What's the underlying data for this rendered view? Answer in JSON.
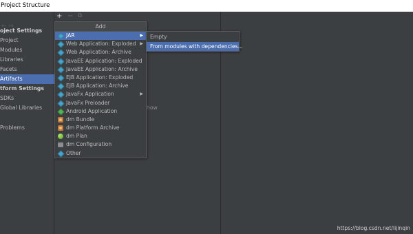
{
  "window": {
    "title": "Project Structure"
  },
  "sidebar": {
    "nav": {
      "back_icon": "arrow-left-icon",
      "forward_icon": "arrow-right-icon"
    },
    "sections": [
      {
        "header": "oject Settings",
        "items": [
          "Project",
          "Modules",
          "Libraries",
          "Facets",
          "Artifacts"
        ]
      },
      {
        "header": "tform Settings",
        "items": [
          "SDKs",
          "Global Libraries"
        ]
      }
    ],
    "problems": "Problems",
    "selected": "Artifacts"
  },
  "toolbar": {
    "add_icon": "+",
    "remove_icon": "−",
    "copy_icon": "⧉"
  },
  "middle": {
    "empty_text": "how"
  },
  "popup": {
    "title": "Add",
    "items": [
      {
        "label": "JAR",
        "icon": "jar-icon",
        "has_submenu": true,
        "selected": true
      },
      {
        "label": "Web Application: Exploded",
        "icon": "web-app-exploded-icon",
        "has_submenu": true
      },
      {
        "label": "Web Application: Archive",
        "icon": "web-app-archive-icon"
      },
      {
        "label": "JavaEE Application: Exploded",
        "icon": "javaee-exploded-icon"
      },
      {
        "label": "JavaEE Application: Archive",
        "icon": "javaee-archive-icon"
      },
      {
        "label": "EJB Application: Exploded",
        "icon": "ejb-exploded-icon"
      },
      {
        "label": "EJB Application: Archive",
        "icon": "ejb-archive-icon"
      },
      {
        "label": "JavaFx Application",
        "icon": "javafx-app-icon",
        "has_submenu": true
      },
      {
        "label": "JavaFx Preloader",
        "icon": "javafx-preloader-icon"
      },
      {
        "label": "Android Application",
        "icon": "android-app-icon"
      },
      {
        "label": "dm Bundle",
        "icon": "dm-bundle-icon"
      },
      {
        "label": "dm Platform Archive",
        "icon": "dm-platform-archive-icon"
      },
      {
        "label": "dm Plan",
        "icon": "dm-plan-icon"
      },
      {
        "label": "dm Configuration",
        "icon": "dm-configuration-icon"
      },
      {
        "label": "Other",
        "icon": "other-icon"
      }
    ]
  },
  "submenu": {
    "items": [
      {
        "label": "Empty"
      },
      {
        "label": "From modules with dependencies...",
        "selected": true
      }
    ]
  },
  "watermark": "https://blog.csdn.net/lijinqin",
  "colors": {
    "selection": "#4b6eaf",
    "background": "#3c3f41",
    "titlebar": "#ffffff"
  }
}
